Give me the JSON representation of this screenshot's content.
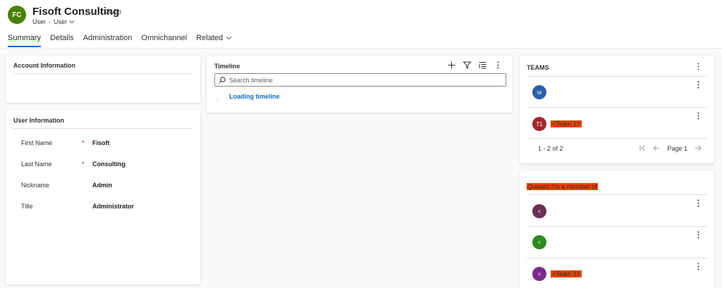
{
  "header": {
    "avatar_initials": "FC",
    "avatar_color": "#498205",
    "title": "Fisoft Consulting",
    "saved": "- Saved",
    "entity": "User",
    "separator": "·",
    "form_selector": "User"
  },
  "tabs": [
    {
      "label": "Summary",
      "active": true
    },
    {
      "label": "Details"
    },
    {
      "label": "Administration"
    },
    {
      "label": "Omnichannel"
    },
    {
      "label": "Related"
    }
  ],
  "account_info": {
    "title": "Account Information"
  },
  "user_info": {
    "title": "User Information",
    "fields": [
      {
        "label": "First Name",
        "required": "*",
        "value": "Fisoft"
      },
      {
        "label": "Last Name",
        "required": "*",
        "value": "Consulting"
      },
      {
        "label": "Nickname",
        "required": "",
        "value": "Admin"
      },
      {
        "label": "Title",
        "required": "",
        "value": "Administrator"
      }
    ]
  },
  "timeline": {
    "title": "Timeline",
    "search_placeholder": "Search timeline",
    "loading_text": "Loading timeline",
    "loading_bullet": "."
  },
  "teams": {
    "title": "TEAMS",
    "rows": [
      {
        "initials": "or",
        "color": "#2b5fa8",
        "name": ""
      },
      {
        "initials": "T1",
        "color": "#a4262c",
        "name": "<Team 1>"
      }
    ],
    "pager": {
      "count": "1 - 2 of 2",
      "page": "Page 1"
    }
  },
  "queues": {
    "title": "Queues I'm a member of",
    "rows": [
      {
        "initials": "<",
        "color": "#6b2f52",
        "name": ""
      },
      {
        "initials": "<",
        "color": "#2d8a1f",
        "name": ""
      },
      {
        "initials": "<",
        "color": "#7a2b8a",
        "name": "<Team 1>"
      }
    ]
  },
  "colors": {
    "accent": "#0f6cbd",
    "highlight": "#e24400",
    "required": "#a4262c"
  }
}
